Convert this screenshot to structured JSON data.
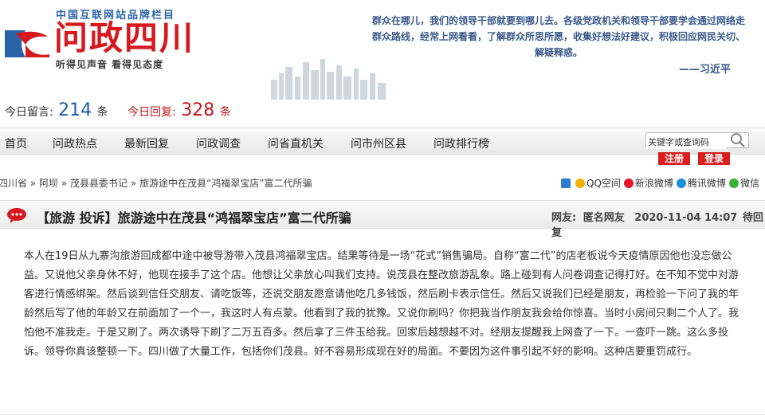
{
  "header": {
    "tagline_top": "中国互联网站品牌栏目",
    "site_title": "问政四川",
    "site_slogan": "听得见声音  看得见态度",
    "quote": "群众在哪儿，我们的领导干部就要到哪儿去。各级党政机关和领导干部要学会通过网络走群众路线，经常上网看看，了解群众所思所愿，收集好想法好建议，积极回应网民关切、解疑释惑。",
    "quote_author": "——习近平"
  },
  "stats": {
    "today_msg_label": "今日留言:",
    "today_msg_count": "214",
    "today_msg_unit": "条",
    "today_reply_label": "今日回复:",
    "today_reply_count": "328",
    "today_reply_unit": "条"
  },
  "nav": {
    "items": [
      "首页",
      "问政热点",
      "最新回复",
      "问政调查",
      "问省直机关",
      "问市州区县",
      "问政排行榜"
    ],
    "search_value": "关键字或查询码",
    "register": "注册",
    "login": "登录"
  },
  "breadcrumb": {
    "items": [
      "四川省",
      "阿坝",
      "茂县县委书记",
      "旅游途中在茂县“鸿福翠宝店”富二代所骗"
    ],
    "sep": "»"
  },
  "share": {
    "items": [
      "QQ空间",
      "新浪微博",
      "腾讯微博",
      "微信"
    ]
  },
  "article": {
    "title": "【旅游 投诉】旅游途中在茂县“鸿福翠宝店”富二代所骗",
    "author_label": "网友:",
    "author": "匿名网友",
    "date": "2020-11-04 14:07",
    "status": "待回复",
    "body": "本人在19日从九寨沟旅游回成都中途中被导游带入茂县鸿福翠宝店。结果等待是一场“花式”销售骗局。自称“富二代”的店老板说今天疫情原因他也没忘做公益。又说他父亲身休不好，他现在接手了这个店。他想让父亲放心叫我们支持。说茂县在整改旅游乱象。路上碰到有人问卷调查记得打好。在不知不觉中对游客进行情感绑架。然后谈到信任交朋友、请吃饭等，还说交朋友愿意请他吃几多钱饭，然后刷卡表示信任。然后又说我们已经是朋友，再检验一下问了我的年龄然后写了他的年龄又在前面加了一个一，我这时人有点蒙。他看到了我的犹豫。又说你刷吗？你把我当作朋友我会给你惊喜。当时小房间只剩二个人了。我怕他不准我走。于是又刷了。两次诱导下刷了二万五百多。然后拿了三件玉给我。回家后越想越不对。经朋友提醒我上网查了一下。一查吓一跳。这么多投诉。领导你真该整顿一下。四川做了大量工作，包括你们茂县。好不容易形成现在好的局面。不要因为这件事引起不好的影响。这种店要重罚成行。"
  },
  "colors": {
    "brand_red": "#d7191d",
    "link_blue": "#1e5fa8",
    "quote_blue": "#3b5a8a"
  }
}
